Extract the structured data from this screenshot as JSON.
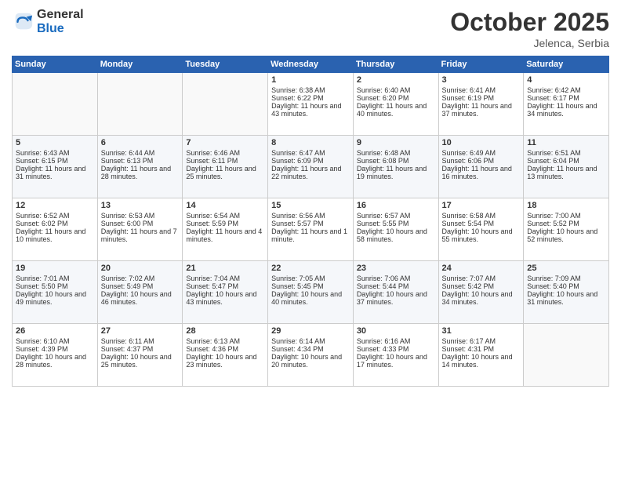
{
  "header": {
    "logo_general": "General",
    "logo_blue": "Blue",
    "month_title": "October 2025",
    "location": "Jelenca, Serbia"
  },
  "days_of_week": [
    "Sunday",
    "Monday",
    "Tuesday",
    "Wednesday",
    "Thursday",
    "Friday",
    "Saturday"
  ],
  "weeks": [
    [
      {
        "day": "",
        "info": ""
      },
      {
        "day": "",
        "info": ""
      },
      {
        "day": "",
        "info": ""
      },
      {
        "day": "1",
        "sunrise": "Sunrise: 6:38 AM",
        "sunset": "Sunset: 6:22 PM",
        "daylight": "Daylight: 11 hours and 43 minutes."
      },
      {
        "day": "2",
        "sunrise": "Sunrise: 6:40 AM",
        "sunset": "Sunset: 6:20 PM",
        "daylight": "Daylight: 11 hours and 40 minutes."
      },
      {
        "day": "3",
        "sunrise": "Sunrise: 6:41 AM",
        "sunset": "Sunset: 6:19 PM",
        "daylight": "Daylight: 11 hours and 37 minutes."
      },
      {
        "day": "4",
        "sunrise": "Sunrise: 6:42 AM",
        "sunset": "Sunset: 6:17 PM",
        "daylight": "Daylight: 11 hours and 34 minutes."
      }
    ],
    [
      {
        "day": "5",
        "sunrise": "Sunrise: 6:43 AM",
        "sunset": "Sunset: 6:15 PM",
        "daylight": "Daylight: 11 hours and 31 minutes."
      },
      {
        "day": "6",
        "sunrise": "Sunrise: 6:44 AM",
        "sunset": "Sunset: 6:13 PM",
        "daylight": "Daylight: 11 hours and 28 minutes."
      },
      {
        "day": "7",
        "sunrise": "Sunrise: 6:46 AM",
        "sunset": "Sunset: 6:11 PM",
        "daylight": "Daylight: 11 hours and 25 minutes."
      },
      {
        "day": "8",
        "sunrise": "Sunrise: 6:47 AM",
        "sunset": "Sunset: 6:09 PM",
        "daylight": "Daylight: 11 hours and 22 minutes."
      },
      {
        "day": "9",
        "sunrise": "Sunrise: 6:48 AM",
        "sunset": "Sunset: 6:08 PM",
        "daylight": "Daylight: 11 hours and 19 minutes."
      },
      {
        "day": "10",
        "sunrise": "Sunrise: 6:49 AM",
        "sunset": "Sunset: 6:06 PM",
        "daylight": "Daylight: 11 hours and 16 minutes."
      },
      {
        "day": "11",
        "sunrise": "Sunrise: 6:51 AM",
        "sunset": "Sunset: 6:04 PM",
        "daylight": "Daylight: 11 hours and 13 minutes."
      }
    ],
    [
      {
        "day": "12",
        "sunrise": "Sunrise: 6:52 AM",
        "sunset": "Sunset: 6:02 PM",
        "daylight": "Daylight: 11 hours and 10 minutes."
      },
      {
        "day": "13",
        "sunrise": "Sunrise: 6:53 AM",
        "sunset": "Sunset: 6:00 PM",
        "daylight": "Daylight: 11 hours and 7 minutes."
      },
      {
        "day": "14",
        "sunrise": "Sunrise: 6:54 AM",
        "sunset": "Sunset: 5:59 PM",
        "daylight": "Daylight: 11 hours and 4 minutes."
      },
      {
        "day": "15",
        "sunrise": "Sunrise: 6:56 AM",
        "sunset": "Sunset: 5:57 PM",
        "daylight": "Daylight: 11 hours and 1 minute."
      },
      {
        "day": "16",
        "sunrise": "Sunrise: 6:57 AM",
        "sunset": "Sunset: 5:55 PM",
        "daylight": "Daylight: 10 hours and 58 minutes."
      },
      {
        "day": "17",
        "sunrise": "Sunrise: 6:58 AM",
        "sunset": "Sunset: 5:54 PM",
        "daylight": "Daylight: 10 hours and 55 minutes."
      },
      {
        "day": "18",
        "sunrise": "Sunrise: 7:00 AM",
        "sunset": "Sunset: 5:52 PM",
        "daylight": "Daylight: 10 hours and 52 minutes."
      }
    ],
    [
      {
        "day": "19",
        "sunrise": "Sunrise: 7:01 AM",
        "sunset": "Sunset: 5:50 PM",
        "daylight": "Daylight: 10 hours and 49 minutes."
      },
      {
        "day": "20",
        "sunrise": "Sunrise: 7:02 AM",
        "sunset": "Sunset: 5:49 PM",
        "daylight": "Daylight: 10 hours and 46 minutes."
      },
      {
        "day": "21",
        "sunrise": "Sunrise: 7:04 AM",
        "sunset": "Sunset: 5:47 PM",
        "daylight": "Daylight: 10 hours and 43 minutes."
      },
      {
        "day": "22",
        "sunrise": "Sunrise: 7:05 AM",
        "sunset": "Sunset: 5:45 PM",
        "daylight": "Daylight: 10 hours and 40 minutes."
      },
      {
        "day": "23",
        "sunrise": "Sunrise: 7:06 AM",
        "sunset": "Sunset: 5:44 PM",
        "daylight": "Daylight: 10 hours and 37 minutes."
      },
      {
        "day": "24",
        "sunrise": "Sunrise: 7:07 AM",
        "sunset": "Sunset: 5:42 PM",
        "daylight": "Daylight: 10 hours and 34 minutes."
      },
      {
        "day": "25",
        "sunrise": "Sunrise: 7:09 AM",
        "sunset": "Sunset: 5:40 PM",
        "daylight": "Daylight: 10 hours and 31 minutes."
      }
    ],
    [
      {
        "day": "26",
        "sunrise": "Sunrise: 6:10 AM",
        "sunset": "Sunset: 4:39 PM",
        "daylight": "Daylight: 10 hours and 28 minutes."
      },
      {
        "day": "27",
        "sunrise": "Sunrise: 6:11 AM",
        "sunset": "Sunset: 4:37 PM",
        "daylight": "Daylight: 10 hours and 25 minutes."
      },
      {
        "day": "28",
        "sunrise": "Sunrise: 6:13 AM",
        "sunset": "Sunset: 4:36 PM",
        "daylight": "Daylight: 10 hours and 23 minutes."
      },
      {
        "day": "29",
        "sunrise": "Sunrise: 6:14 AM",
        "sunset": "Sunset: 4:34 PM",
        "daylight": "Daylight: 10 hours and 20 minutes."
      },
      {
        "day": "30",
        "sunrise": "Sunrise: 6:16 AM",
        "sunset": "Sunset: 4:33 PM",
        "daylight": "Daylight: 10 hours and 17 minutes."
      },
      {
        "day": "31",
        "sunrise": "Sunrise: 6:17 AM",
        "sunset": "Sunset: 4:31 PM",
        "daylight": "Daylight: 10 hours and 14 minutes."
      },
      {
        "day": "",
        "info": ""
      }
    ]
  ]
}
